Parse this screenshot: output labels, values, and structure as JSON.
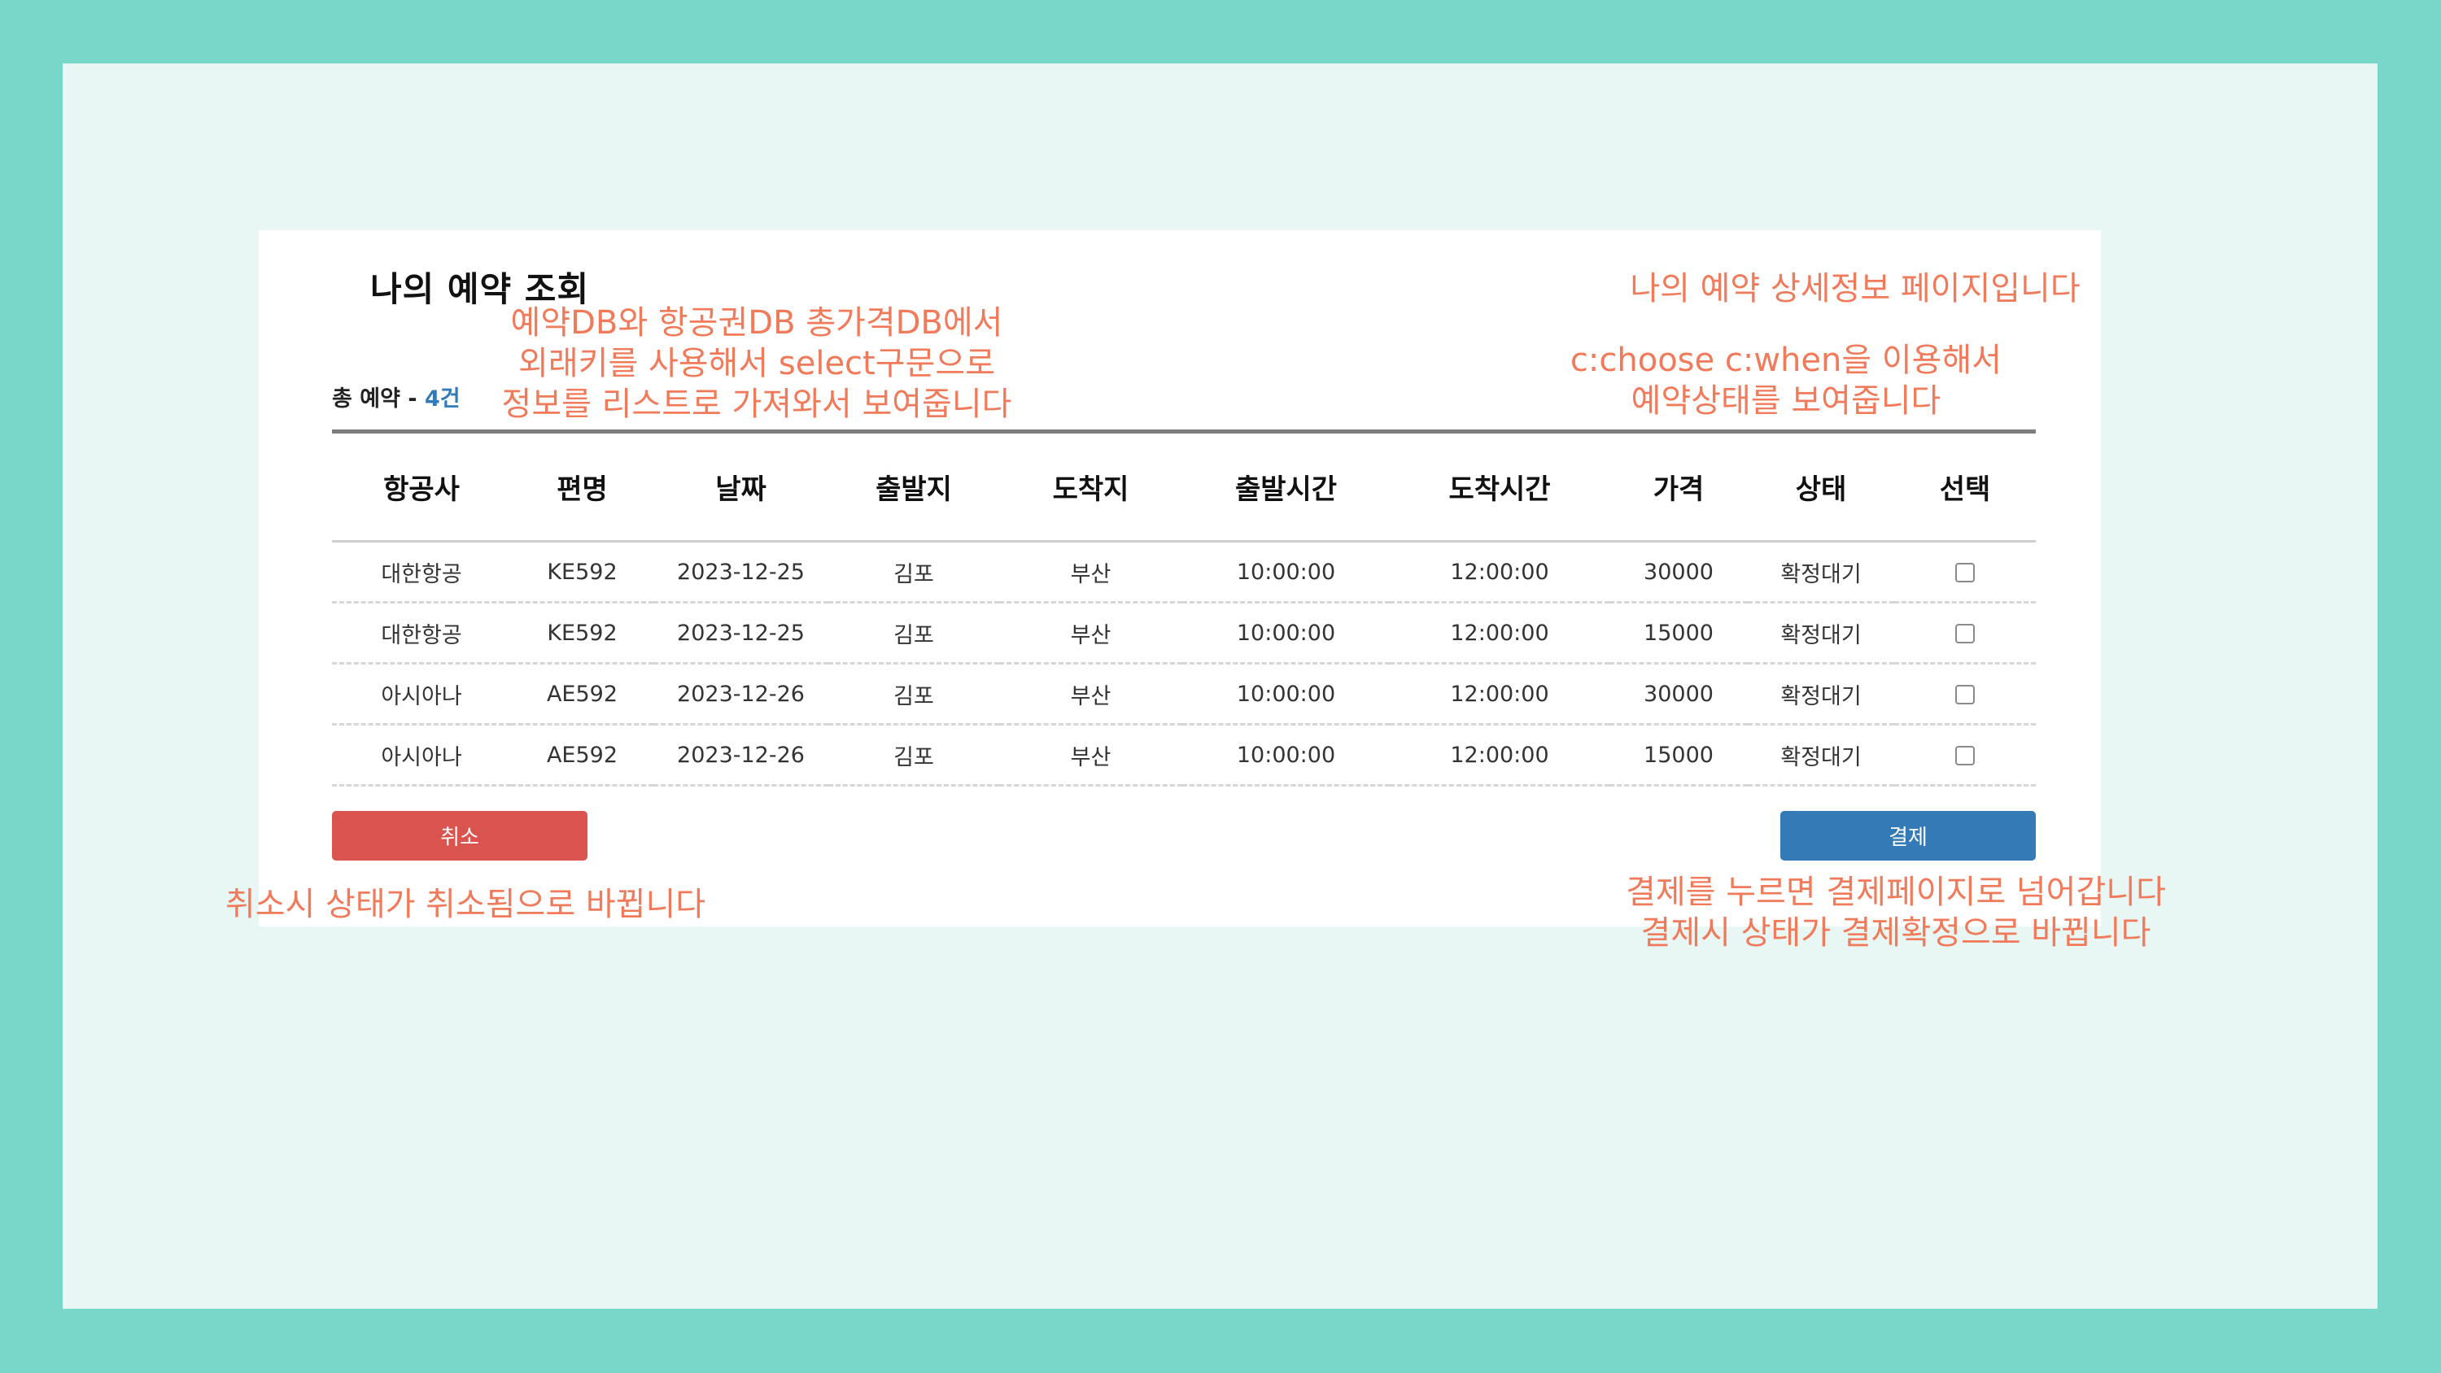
{
  "colors": {
    "outer_bg": "#78d7c8",
    "slide_bg": "#e8f7f4",
    "annotation": "#f07a5a",
    "cancel_button": "#d9534f",
    "pay_button": "#337ab7",
    "count_accent": "#337ab7"
  },
  "page": {
    "title": "나의 예약 조회",
    "total_label": "총 예약 - ",
    "total_count": "4건"
  },
  "table": {
    "columns": [
      "항공사",
      "편명",
      "날짜",
      "출발지",
      "도착지",
      "출발시간",
      "도착시간",
      "가격",
      "상태",
      "선택"
    ],
    "rows": [
      {
        "airline": "대한항공",
        "flight": "KE592",
        "date": "2023-12-25",
        "from": "김포",
        "to": "부산",
        "departure": "10:00:00",
        "arrival": "12:00:00",
        "price": "30000",
        "status": "확정대기"
      },
      {
        "airline": "대한항공",
        "flight": "KE592",
        "date": "2023-12-25",
        "from": "김포",
        "to": "부산",
        "departure": "10:00:00",
        "arrival": "12:00:00",
        "price": "15000",
        "status": "확정대기"
      },
      {
        "airline": "아시아나",
        "flight": "AE592",
        "date": "2023-12-26",
        "from": "김포",
        "to": "부산",
        "departure": "10:00:00",
        "arrival": "12:00:00",
        "price": "30000",
        "status": "확정대기"
      },
      {
        "airline": "아시아나",
        "flight": "AE592",
        "date": "2023-12-26",
        "from": "김포",
        "to": "부산",
        "departure": "10:00:00",
        "arrival": "12:00:00",
        "price": "15000",
        "status": "확정대기"
      }
    ]
  },
  "buttons": {
    "cancel_label": "취소",
    "pay_label": "결제"
  },
  "annotations": {
    "db_note": [
      "예약DB와 항공권DB 총가격DB에서",
      "외래키를 사용해서 select구문으로",
      "정보를 리스트로 가져와서 보여줍니다"
    ],
    "page_note": "나의 예약 상세정보 페이지입니다",
    "choose_note": [
      "c:choose c:when을 이용해서",
      "예약상태를 보여줍니다"
    ],
    "cancel_note": "취소시 상태가 취소됨으로 바뀝니다",
    "pay_note": [
      "결제를 누르면 결제페이지로 넘어갑니다",
      "결제시 상태가 결제확정으로 바뀝니다"
    ]
  }
}
